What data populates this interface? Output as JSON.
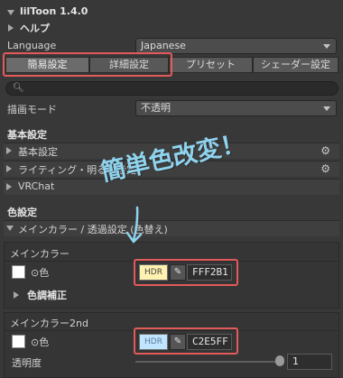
{
  "header": {
    "title": "lilToon 1.4.0",
    "help": "ヘルプ"
  },
  "language": {
    "label": "Language",
    "value": "Japanese"
  },
  "tabs": [
    {
      "label": "簡易設定",
      "active": true
    },
    {
      "label": "詳細設定",
      "active": false
    },
    {
      "label": "プリセット",
      "active": false
    },
    {
      "label": "シェーダー設定",
      "active": false
    }
  ],
  "render_mode": {
    "label": "描画モード",
    "value": "不透明"
  },
  "basic": {
    "heading": "基本設定"
  },
  "sections": {
    "basic_settings": "基本設定",
    "lighting": "ライティング・明るさ設定",
    "vrchat": "VRChat"
  },
  "color": {
    "heading": "色設定",
    "main_section": "メインカラー / 透過設定 (色替え)"
  },
  "main_color": {
    "title": "メインカラー",
    "color_label": "色",
    "hdr": "HDR",
    "hex": "FFF2B1",
    "swatch_color": "#FFFFFF",
    "correction": "色調補正"
  },
  "main_color_2nd": {
    "title": "メインカラー2nd",
    "color_label": "色",
    "hdr": "HDR",
    "hex": "C2E5FF",
    "swatch_color": "#FFFFFF",
    "opacity_label": "透明度",
    "opacity_value": "1",
    "opacity_fraction": 1.0
  },
  "annotation": {
    "text": "簡単色改変！",
    "color": "#8fd3ee"
  },
  "highlight_color": "#e35a5a"
}
